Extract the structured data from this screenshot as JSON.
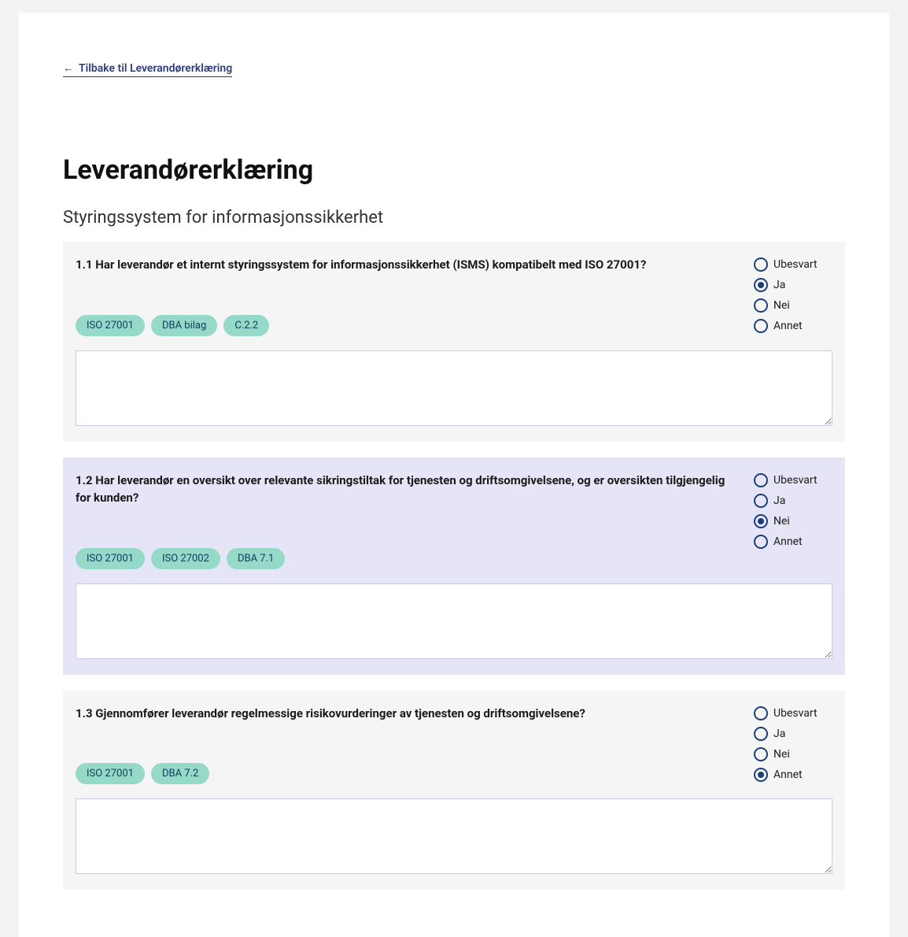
{
  "back_link_label": "Tilbake til Leverandørerklæring",
  "page_title": "Leverandørerklæring",
  "section_title": "Styringssystem for informasjonssikkerhet",
  "option_labels": [
    "Ubesvart",
    "Ja",
    "Nei",
    "Annet"
  ],
  "questions": [
    {
      "text": "1.1 Har leverandør et internt styringssystem for informasjonssikkerhet (ISMS) kompatibelt med ISO 27001?",
      "tags": [
        "ISO 27001",
        "DBA bilag",
        "C.2.2"
      ],
      "selected": 1,
      "bg": "gray",
      "note": ""
    },
    {
      "text": "1.2 Har leverandør en oversikt over relevante sikringstiltak for tjenesten og driftsomgivelsene, og er oversikten tilgjengelig for kunden?",
      "tags": [
        "ISO 27001",
        "ISO 27002",
        "DBA 7.1"
      ],
      "selected": 2,
      "bg": "purple",
      "note": ""
    },
    {
      "text": "1.3 Gjennomfører leverandør regelmessige risikovurderinger av tjenesten og driftsomgivelsene?",
      "tags": [
        "ISO 27001",
        "DBA 7.2"
      ],
      "selected": 3,
      "bg": "gray",
      "note": ""
    }
  ]
}
